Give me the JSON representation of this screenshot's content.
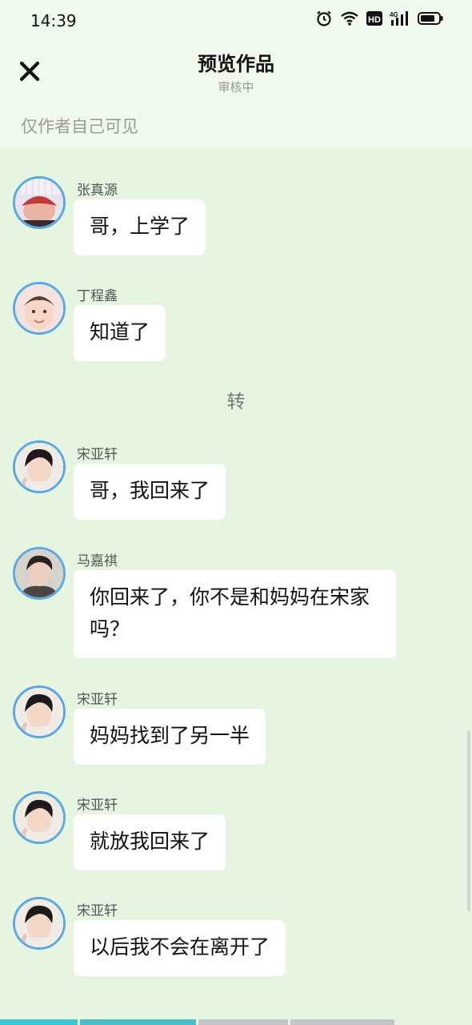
{
  "status_bar": {
    "time": "14:39"
  },
  "header": {
    "title": "预览作品",
    "subtitle": "审核中",
    "visibility_note": "仅作者自己可见"
  },
  "messages": [
    {
      "name": "张真源",
      "text": "哥，上学了"
    },
    {
      "name": "丁程鑫",
      "text": "知道了"
    },
    {
      "name": "宋亚轩",
      "text": "哥，我回来了"
    },
    {
      "name": "马嘉祺",
      "text": "你回来了，你不是和妈妈在宋家吗？"
    },
    {
      "name": "宋亚轩",
      "text": "妈妈找到了另一半"
    },
    {
      "name": "宋亚轩",
      "text": "就放我回来了"
    },
    {
      "name": "宋亚轩",
      "text": "以后我不会在离开了"
    }
  ],
  "divider": {
    "text": "转"
  },
  "colors": {
    "background": "#e6f5df",
    "header_background": "#effaed",
    "avatar_border": "#5aa9e6",
    "bubble": "#ffffff"
  }
}
